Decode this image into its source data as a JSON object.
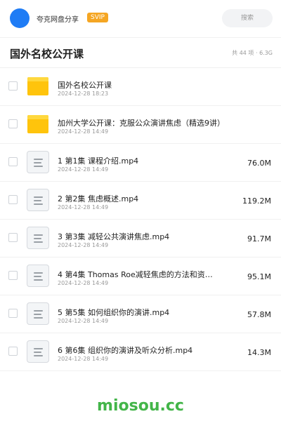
{
  "topbar": {
    "owner": "夸克网盘分享",
    "badge": "SVIP",
    "search_label": "搜索"
  },
  "header": {
    "title": "国外名校公开课",
    "summary": "共 44 项 · 6.3G"
  },
  "colors": {
    "avatar": "#1f7cf5",
    "badge": "#f5a623",
    "folder": "#ffc40c",
    "watermark": "#43b549"
  },
  "files": [
    {
      "name": "国外名校公开课",
      "date": "2024-12-28 18:23",
      "size": "",
      "icon": "folder-icon"
    },
    {
      "name": "加州大学公开课：克服公众演讲焦虑（精选9讲）",
      "date": "2024-12-28 14:49",
      "size": "",
      "icon": "folder-icon"
    },
    {
      "name": "1 第1集 课程介绍.mp4",
      "date": "2024-12-28 14:49",
      "size": "76.0M",
      "icon": "file-icon"
    },
    {
      "name": "2 第2集 焦虑概述.mp4",
      "date": "2024-12-28 14:49",
      "size": "119.2M",
      "icon": "file-icon"
    },
    {
      "name": "3 第3集 减轻公共演讲焦虑.mp4",
      "date": "2024-12-28 14:49",
      "size": "91.7M",
      "icon": "file-icon"
    },
    {
      "name": "4 第4集 Thomas Roe减轻焦虑的方法和资…",
      "date": "2024-12-28 14:49",
      "size": "95.1M",
      "icon": "file-icon"
    },
    {
      "name": "5 第5集 如何组织你的演讲.mp4",
      "date": "2024-12-28 14:49",
      "size": "57.8M",
      "icon": "file-icon"
    },
    {
      "name": "6 第6集 组织你的演讲及听众分析.mp4",
      "date": "2024-12-28 14:49",
      "size": "14.3M",
      "icon": "file-icon"
    }
  ],
  "watermark": "miosou.cc"
}
